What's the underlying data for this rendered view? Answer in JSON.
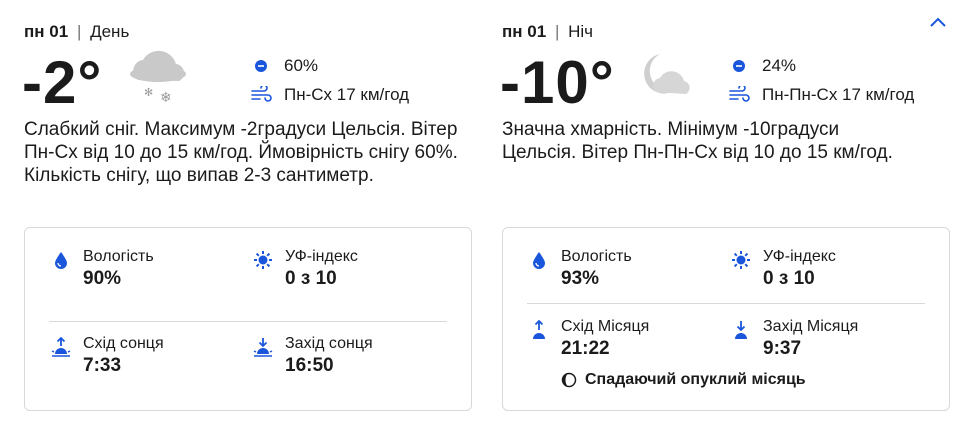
{
  "colors": {
    "accent": "#1a56db",
    "text": "#1b1b1b",
    "border": "#d9d9d9",
    "cloud": "#c9c9c9"
  },
  "day": {
    "weekday": "пн",
    "date": "01",
    "separator": "|",
    "part": "День",
    "temperature": "-2°",
    "condition_icon": "cloud-snow-icon",
    "precipitation": "60%",
    "wind": "Пн-Сх 17 км/год",
    "description": "Слабкий сніг. Максимум -2градуси Цельсія. Вітер Пн-Сх від 10 до 15 км/год. Ймовірність снігу 60%. Кількість снігу, що випав 2-3 сантиметр.",
    "details": {
      "humidity_label": "Вологість",
      "humidity_value": "90%",
      "uv_label": "УФ-індекс",
      "uv_value": "0 з 10",
      "rise_label": "Схід сонця",
      "rise_value": "7:33",
      "set_label": "Захід сонця",
      "set_value": "16:50"
    }
  },
  "night": {
    "weekday": "пн",
    "date": "01",
    "separator": "|",
    "part": "Ніч",
    "temperature": "-10°",
    "condition_icon": "moon-cloud-icon",
    "precipitation": "24%",
    "wind": "Пн-Пн-Сх 17 км/год",
    "description": "Значна хмарність. Мінімум -10градуси Цельсія. Вітер Пн-Пн-Сх від 10 до 15 км/год.",
    "details": {
      "humidity_label": "Вологість",
      "humidity_value": "93%",
      "uv_label": "УФ-індекс",
      "uv_value": "0 з 10",
      "rise_label": "Схід Місяця",
      "rise_value": "21:22",
      "set_label": "Захід Місяця",
      "set_value": "9:37",
      "moon_phase": "Спадаючий опуклий місяць"
    }
  }
}
